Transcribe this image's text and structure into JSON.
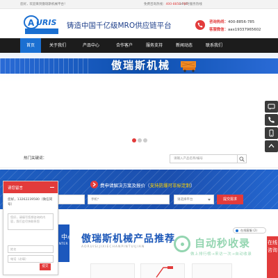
{
  "topbar": {
    "welcome": "您好，欢迎来到傲瑞斯机械平台！",
    "hotline_label": "免费咨询热线：",
    "hotline_number": "400-8856-785",
    "service": "24小时服务热线"
  },
  "header": {
    "logo_text": "AURIS",
    "logo_cn": "傲瑞斯机械",
    "slogan": "铸造中国千亿级MRO供应链平台",
    "hotline_label": "咨询热线：",
    "hotline_value": "400-8856-785",
    "wechat_label": "客服微信：",
    "wechat_value": "aax19337965602"
  },
  "nav": {
    "items": [
      {
        "label": "首页",
        "active": true
      },
      {
        "label": "关于我们"
      },
      {
        "label": "产品中心"
      },
      {
        "label": "合作客户"
      },
      {
        "label": "服务支持"
      },
      {
        "label": "新闻动态"
      },
      {
        "label": "联系我们"
      }
    ]
  },
  "banner": {
    "title": "傲瑞斯机械"
  },
  "search": {
    "hot_keywords_label": "热门关键词：",
    "placeholder": "请输入产品名称/编号"
  },
  "form": {
    "title_prefix": "费申请解决方案及报价（",
    "title_highlight": "支持防爆可非标定制",
    "title_suffix": "）",
    "phone_placeholder": "手机*",
    "category_placeholder": "请选择平台",
    "submit_label": "提交需求"
  },
  "products": {
    "center_cn": "中心",
    "center_en": "CENTER",
    "title": "傲瑞斯机械产品推荐",
    "subtitle": "AORUISIJIXIECHANPINTUIJIAN"
  },
  "popup": {
    "title": "请您留言",
    "description": "您好，13262239580（微信同号）",
    "message_placeholder": "您好，请填写您想咨询的内容，我们会尽快联系您",
    "name_placeholder": "姓名",
    "phone_placeholder": "电话（必填）",
    "submit_label": "提交"
  },
  "chat_mini": {
    "label": "在线客服 (2)"
  },
  "online": {
    "label": "在线咨询"
  },
  "watermark": {
    "title": "自动秒收录",
    "subtitle": "做上排行榜→来访一次→自动收录"
  }
}
